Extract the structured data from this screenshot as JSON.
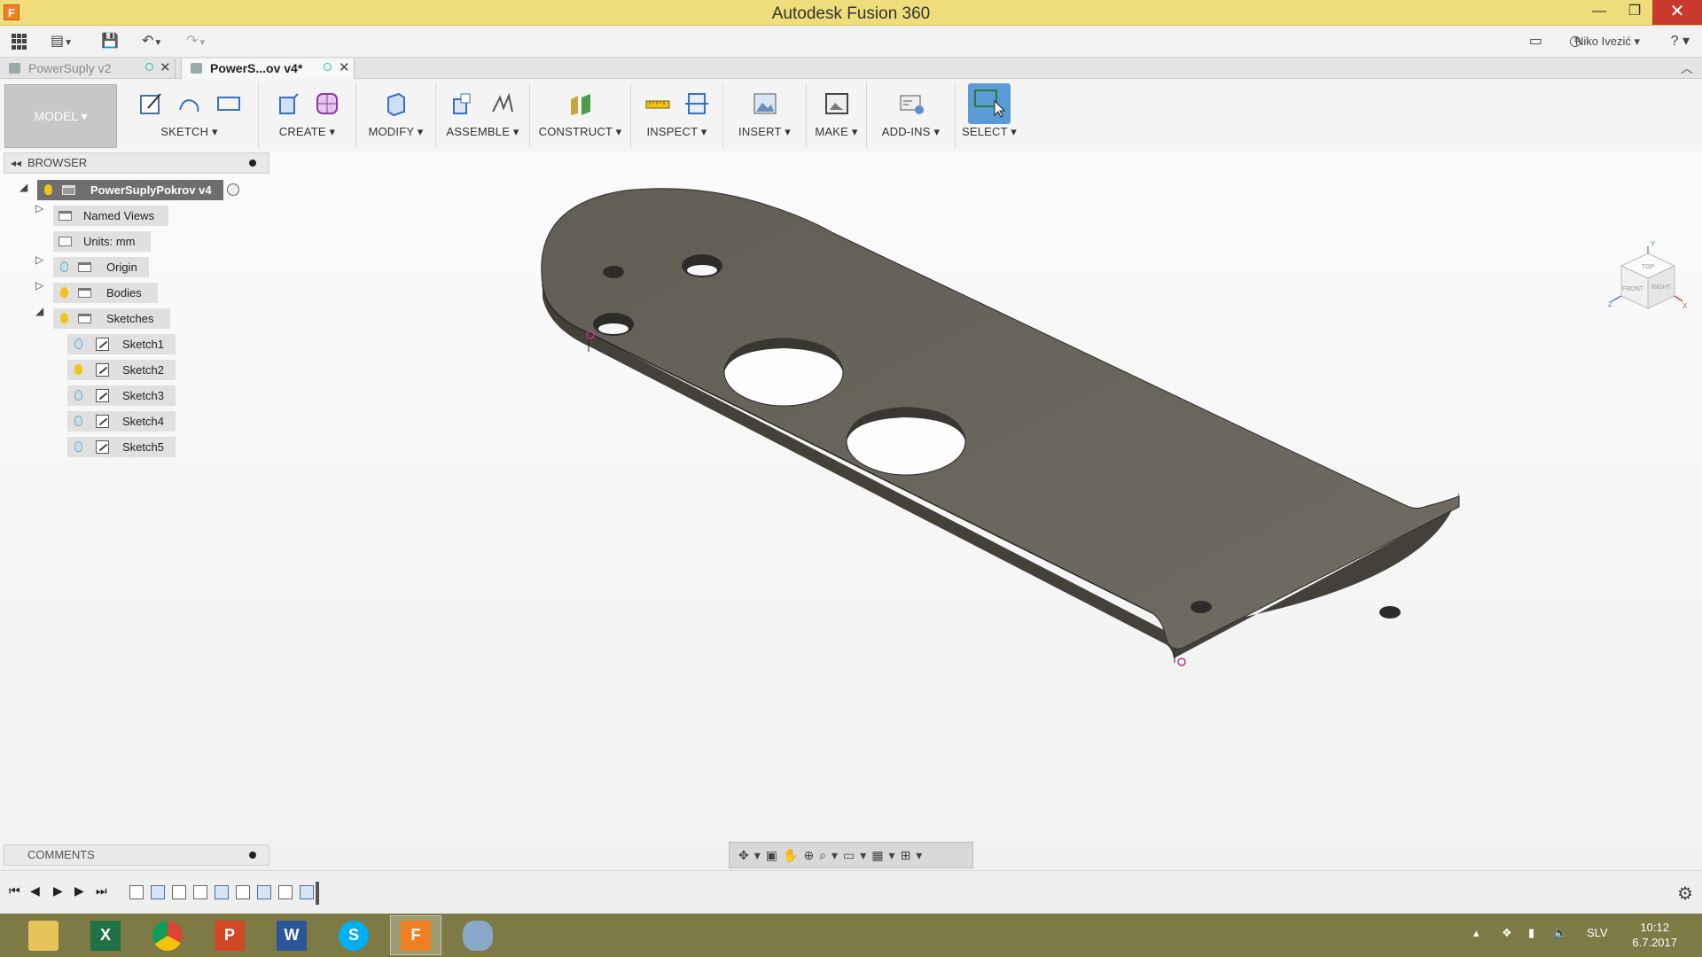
{
  "window": {
    "title": "Autodesk Fusion 360",
    "app_icon": "F"
  },
  "qat": {
    "user": "Niko Ivezić ▾",
    "help": "? ▾"
  },
  "tabs": [
    {
      "label": "PowerSuply v2",
      "active": false
    },
    {
      "label": "PowerS...ov v4*",
      "active": true
    }
  ],
  "ribbon": {
    "workspace": "MODEL ▾",
    "groups": [
      {
        "label": "SKETCH ▾"
      },
      {
        "label": "CREATE ▾"
      },
      {
        "label": "MODIFY ▾"
      },
      {
        "label": "ASSEMBLE ▾"
      },
      {
        "label": "CONSTRUCT ▾"
      },
      {
        "label": "INSPECT ▾"
      },
      {
        "label": "INSERT ▾"
      },
      {
        "label": "MAKE ▾"
      },
      {
        "label": "ADD-INS ▾"
      },
      {
        "label": "SELECT ▾"
      }
    ]
  },
  "browser": {
    "title": "BROWSER",
    "root": "PowerSuplyPokrov v4",
    "items": [
      {
        "label": "Named Views"
      },
      {
        "label": "Units: mm"
      },
      {
        "label": "Origin"
      },
      {
        "label": "Bodies"
      },
      {
        "label": "Sketches"
      }
    ],
    "sketches": [
      "Sketch1",
      "Sketch2",
      "Sketch3",
      "Sketch4",
      "Sketch5"
    ]
  },
  "comments": {
    "title": "COMMENTS"
  },
  "viewcube": {
    "top": "TOP",
    "front": "FRONT",
    "right": "RIGHT",
    "x": "X",
    "y": "Y",
    "z": "Z"
  },
  "taskbar": {
    "language": "SLV",
    "time": "10:12",
    "date": "6.7.2017"
  },
  "colors": {
    "title_bar": "#efdc7a",
    "select_active": "#5b9bd5",
    "part": "#6d6960",
    "taskbar": "#7d7a46"
  }
}
